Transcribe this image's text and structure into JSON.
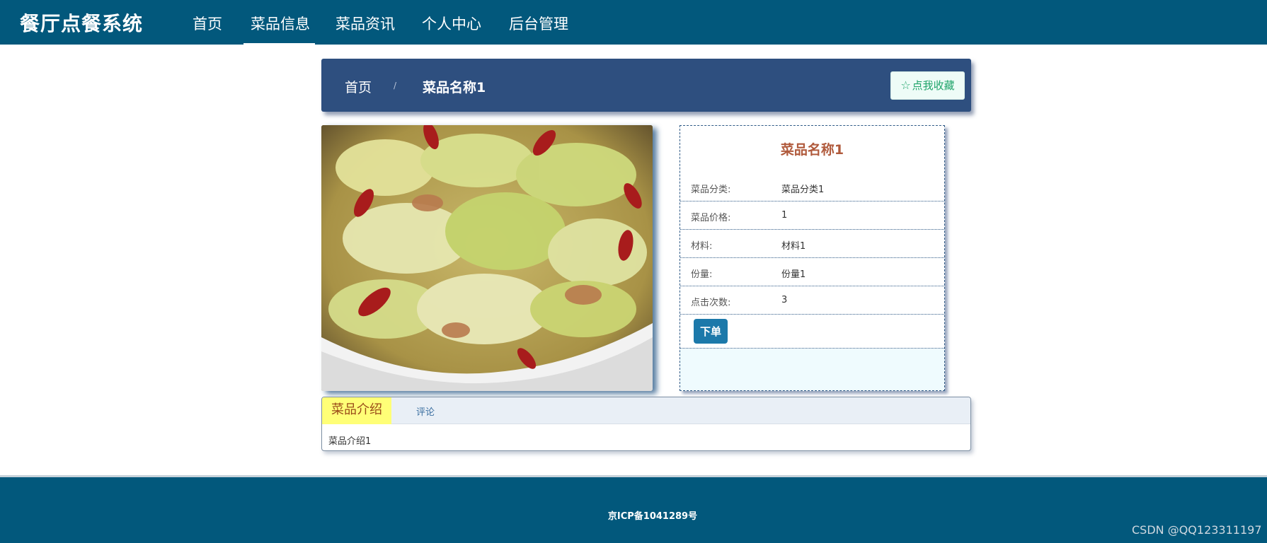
{
  "header": {
    "logo": "餐厅点餐系统",
    "nav": [
      {
        "label": "首页",
        "active": false
      },
      {
        "label": "菜品信息",
        "active": true
      },
      {
        "label": "菜品资讯",
        "active": false
      },
      {
        "label": "个人中心",
        "active": false
      },
      {
        "label": "后台管理",
        "active": false
      }
    ]
  },
  "breadcrumb": {
    "home": "首页",
    "separator": "/",
    "current": "菜品名称1",
    "favorite_label": "点我收藏",
    "favorite_icon": "star-outline-icon"
  },
  "dish": {
    "image_alt": "dish-photo",
    "title": "菜品名称1",
    "fields": [
      {
        "key": "菜品分类:",
        "value": "菜品分类1"
      },
      {
        "key": "菜品价格:",
        "value": "1"
      },
      {
        "key": "材料:",
        "value": "材料1"
      },
      {
        "key": "份量:",
        "value": "份量1"
      },
      {
        "key": "点击次数:",
        "value": "3"
      }
    ],
    "order_label": "下单"
  },
  "tabs": {
    "items": [
      {
        "label": "菜品介绍",
        "active": true
      },
      {
        "label": "评论",
        "active": false
      }
    ],
    "content": "菜品介绍1"
  },
  "footer": {
    "icp": "京ICP备1041289号",
    "watermark": "CSDN @QQ123311197"
  },
  "colors": {
    "nav_bg": "#02587c",
    "breadcrumb_bg": "#2e4f7f",
    "title_color": "#b05a3c",
    "order_button": "#1c79aa",
    "active_tab_bg": "#ffff77"
  }
}
